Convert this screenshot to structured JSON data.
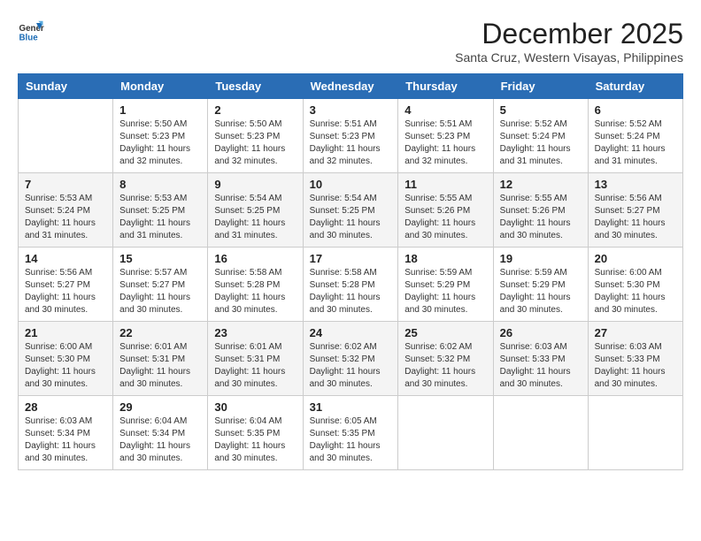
{
  "logo": {
    "text_general": "General",
    "text_blue": "Blue"
  },
  "header": {
    "month": "December 2025",
    "location": "Santa Cruz, Western Visayas, Philippines"
  },
  "weekdays": [
    "Sunday",
    "Monday",
    "Tuesday",
    "Wednesday",
    "Thursday",
    "Friday",
    "Saturday"
  ],
  "weeks": [
    [
      {
        "day": "",
        "sunrise": "",
        "sunset": "",
        "daylight": ""
      },
      {
        "day": "1",
        "sunrise": "Sunrise: 5:50 AM",
        "sunset": "Sunset: 5:23 PM",
        "daylight": "Daylight: 11 hours and 32 minutes."
      },
      {
        "day": "2",
        "sunrise": "Sunrise: 5:50 AM",
        "sunset": "Sunset: 5:23 PM",
        "daylight": "Daylight: 11 hours and 32 minutes."
      },
      {
        "day": "3",
        "sunrise": "Sunrise: 5:51 AM",
        "sunset": "Sunset: 5:23 PM",
        "daylight": "Daylight: 11 hours and 32 minutes."
      },
      {
        "day": "4",
        "sunrise": "Sunrise: 5:51 AM",
        "sunset": "Sunset: 5:23 PM",
        "daylight": "Daylight: 11 hours and 32 minutes."
      },
      {
        "day": "5",
        "sunrise": "Sunrise: 5:52 AM",
        "sunset": "Sunset: 5:24 PM",
        "daylight": "Daylight: 11 hours and 31 minutes."
      },
      {
        "day": "6",
        "sunrise": "Sunrise: 5:52 AM",
        "sunset": "Sunset: 5:24 PM",
        "daylight": "Daylight: 11 hours and 31 minutes."
      }
    ],
    [
      {
        "day": "7",
        "sunrise": "Sunrise: 5:53 AM",
        "sunset": "Sunset: 5:24 PM",
        "daylight": "Daylight: 11 hours and 31 minutes."
      },
      {
        "day": "8",
        "sunrise": "Sunrise: 5:53 AM",
        "sunset": "Sunset: 5:25 PM",
        "daylight": "Daylight: 11 hours and 31 minutes."
      },
      {
        "day": "9",
        "sunrise": "Sunrise: 5:54 AM",
        "sunset": "Sunset: 5:25 PM",
        "daylight": "Daylight: 11 hours and 31 minutes."
      },
      {
        "day": "10",
        "sunrise": "Sunrise: 5:54 AM",
        "sunset": "Sunset: 5:25 PM",
        "daylight": "Daylight: 11 hours and 30 minutes."
      },
      {
        "day": "11",
        "sunrise": "Sunrise: 5:55 AM",
        "sunset": "Sunset: 5:26 PM",
        "daylight": "Daylight: 11 hours and 30 minutes."
      },
      {
        "day": "12",
        "sunrise": "Sunrise: 5:55 AM",
        "sunset": "Sunset: 5:26 PM",
        "daylight": "Daylight: 11 hours and 30 minutes."
      },
      {
        "day": "13",
        "sunrise": "Sunrise: 5:56 AM",
        "sunset": "Sunset: 5:27 PM",
        "daylight": "Daylight: 11 hours and 30 minutes."
      }
    ],
    [
      {
        "day": "14",
        "sunrise": "Sunrise: 5:56 AM",
        "sunset": "Sunset: 5:27 PM",
        "daylight": "Daylight: 11 hours and 30 minutes."
      },
      {
        "day": "15",
        "sunrise": "Sunrise: 5:57 AM",
        "sunset": "Sunset: 5:27 PM",
        "daylight": "Daylight: 11 hours and 30 minutes."
      },
      {
        "day": "16",
        "sunrise": "Sunrise: 5:58 AM",
        "sunset": "Sunset: 5:28 PM",
        "daylight": "Daylight: 11 hours and 30 minutes."
      },
      {
        "day": "17",
        "sunrise": "Sunrise: 5:58 AM",
        "sunset": "Sunset: 5:28 PM",
        "daylight": "Daylight: 11 hours and 30 minutes."
      },
      {
        "day": "18",
        "sunrise": "Sunrise: 5:59 AM",
        "sunset": "Sunset: 5:29 PM",
        "daylight": "Daylight: 11 hours and 30 minutes."
      },
      {
        "day": "19",
        "sunrise": "Sunrise: 5:59 AM",
        "sunset": "Sunset: 5:29 PM",
        "daylight": "Daylight: 11 hours and 30 minutes."
      },
      {
        "day": "20",
        "sunrise": "Sunrise: 6:00 AM",
        "sunset": "Sunset: 5:30 PM",
        "daylight": "Daylight: 11 hours and 30 minutes."
      }
    ],
    [
      {
        "day": "21",
        "sunrise": "Sunrise: 6:00 AM",
        "sunset": "Sunset: 5:30 PM",
        "daylight": "Daylight: 11 hours and 30 minutes."
      },
      {
        "day": "22",
        "sunrise": "Sunrise: 6:01 AM",
        "sunset": "Sunset: 5:31 PM",
        "daylight": "Daylight: 11 hours and 30 minutes."
      },
      {
        "day": "23",
        "sunrise": "Sunrise: 6:01 AM",
        "sunset": "Sunset: 5:31 PM",
        "daylight": "Daylight: 11 hours and 30 minutes."
      },
      {
        "day": "24",
        "sunrise": "Sunrise: 6:02 AM",
        "sunset": "Sunset: 5:32 PM",
        "daylight": "Daylight: 11 hours and 30 minutes."
      },
      {
        "day": "25",
        "sunrise": "Sunrise: 6:02 AM",
        "sunset": "Sunset: 5:32 PM",
        "daylight": "Daylight: 11 hours and 30 minutes."
      },
      {
        "day": "26",
        "sunrise": "Sunrise: 6:03 AM",
        "sunset": "Sunset: 5:33 PM",
        "daylight": "Daylight: 11 hours and 30 minutes."
      },
      {
        "day": "27",
        "sunrise": "Sunrise: 6:03 AM",
        "sunset": "Sunset: 5:33 PM",
        "daylight": "Daylight: 11 hours and 30 minutes."
      }
    ],
    [
      {
        "day": "28",
        "sunrise": "Sunrise: 6:03 AM",
        "sunset": "Sunset: 5:34 PM",
        "daylight": "Daylight: 11 hours and 30 minutes."
      },
      {
        "day": "29",
        "sunrise": "Sunrise: 6:04 AM",
        "sunset": "Sunset: 5:34 PM",
        "daylight": "Daylight: 11 hours and 30 minutes."
      },
      {
        "day": "30",
        "sunrise": "Sunrise: 6:04 AM",
        "sunset": "Sunset: 5:35 PM",
        "daylight": "Daylight: 11 hours and 30 minutes."
      },
      {
        "day": "31",
        "sunrise": "Sunrise: 6:05 AM",
        "sunset": "Sunset: 5:35 PM",
        "daylight": "Daylight: 11 hours and 30 minutes."
      },
      {
        "day": "",
        "sunrise": "",
        "sunset": "",
        "daylight": ""
      },
      {
        "day": "",
        "sunrise": "",
        "sunset": "",
        "daylight": ""
      },
      {
        "day": "",
        "sunrise": "",
        "sunset": "",
        "daylight": ""
      }
    ]
  ]
}
